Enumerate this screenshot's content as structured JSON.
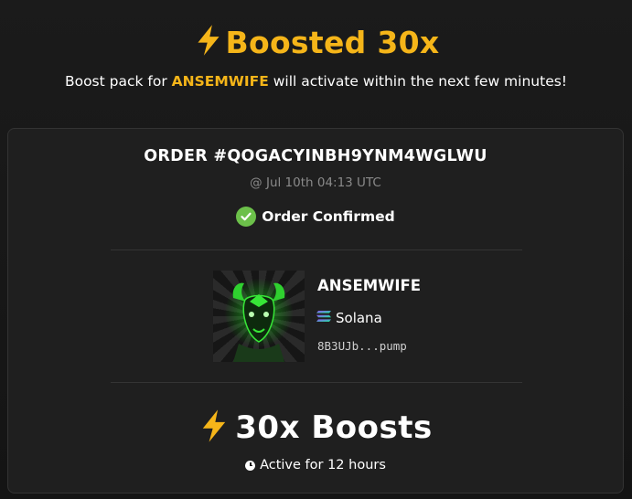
{
  "header": {
    "title": "Boosted 30x",
    "subtitle_prefix": "Boost pack for ",
    "subtitle_token": "ANSEMWIFE",
    "subtitle_suffix": " will activate within the next few minutes!"
  },
  "order": {
    "title": "ORDER #QOGACYINBH9YNM4WGLWU",
    "time": "@ Jul 10th 04:13 UTC",
    "status": "Order Confirmed"
  },
  "token": {
    "name": "ANSEMWIFE",
    "chain": "Solana",
    "address": "8B3UJb...pump"
  },
  "boost": {
    "label": "30x Boosts",
    "duration": "Active for 12 hours"
  },
  "colors": {
    "accent": "#f5b519",
    "success": "#6cc04a",
    "card_bg": "#1f1f1f"
  },
  "icons": {
    "title": "lightning-icon",
    "status": "check-circle-icon",
    "chain": "solana-icon",
    "duration": "clock-icon"
  }
}
